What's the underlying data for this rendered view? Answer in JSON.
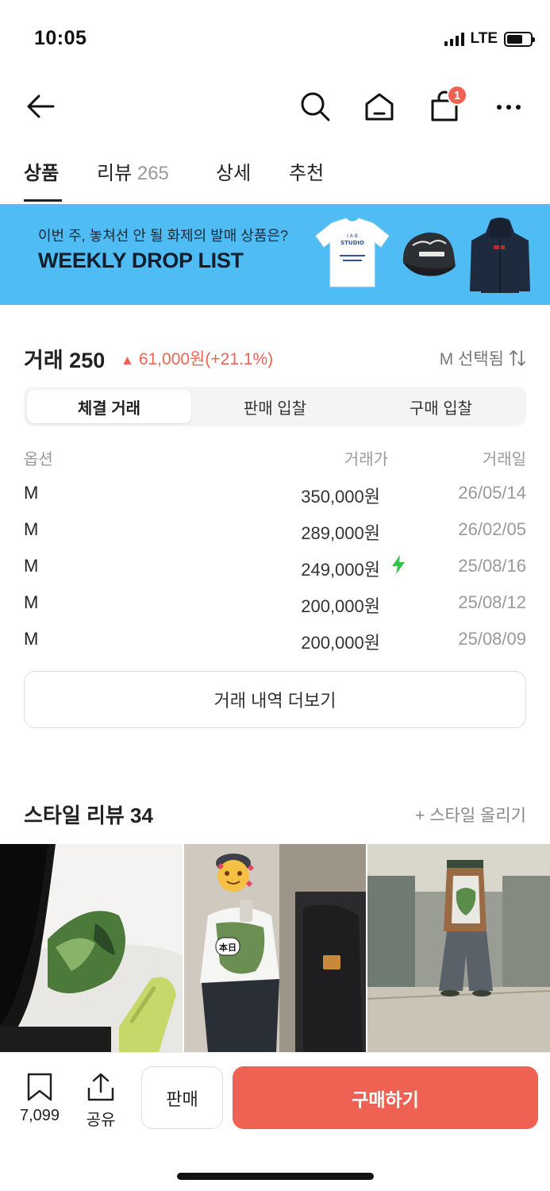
{
  "status": {
    "time": "10:05",
    "network": "LTE"
  },
  "nav": {
    "cart_badge": "1",
    "icons": [
      "back-arrow-icon",
      "search-icon",
      "home-icon",
      "shopping-bag-icon",
      "more-icon"
    ]
  },
  "tabs": [
    {
      "label": "상품",
      "count": ""
    },
    {
      "label": "리뷰",
      "count": "265"
    },
    {
      "label": "상세",
      "count": ""
    },
    {
      "label": "추천",
      "count": ""
    }
  ],
  "banner": {
    "subtitle": "이번 주, 놓쳐선 안 될 화제의 발매 상품은?",
    "title": "WEEKLY DROP LIST",
    "tshirt_text": "I A B STUDIO",
    "cap_text": "Stüssy",
    "bg_color": "#4fbdf3"
  },
  "trade": {
    "title": "거래 250",
    "change": "61,000원(+21.1%)",
    "option_label": "M 선택됨",
    "up_color": "#ef6253"
  },
  "segments": [
    "체결 거래",
    "판매 입찰",
    "구매 입찰"
  ],
  "table": {
    "headers": {
      "option": "옵션",
      "price": "거래가",
      "date": "거래일"
    },
    "rows": [
      {
        "option": "M",
        "price": "350,000원",
        "date": "26/05/14",
        "fast": false
      },
      {
        "option": "M",
        "price": "289,000원",
        "date": "26/02/05",
        "fast": false
      },
      {
        "option": "M",
        "price": "249,000원",
        "date": "25/08/16",
        "fast": true
      },
      {
        "option": "M",
        "price": "200,000원",
        "date": "25/08/12",
        "fast": false
      },
      {
        "option": "M",
        "price": "200,000원",
        "date": "25/08/09",
        "fast": false
      }
    ]
  },
  "more_button": "거래 내역 더보기",
  "style": {
    "title": "스타일 리뷰 34",
    "upload": "+ 스타일 올리기",
    "photo3_sign_text": "本日"
  },
  "bottom": {
    "bookmark_count": "7,099",
    "share_label": "공유",
    "sell_label": "판매",
    "buy_label": "구매하기",
    "buy_color": "#ef6253"
  }
}
